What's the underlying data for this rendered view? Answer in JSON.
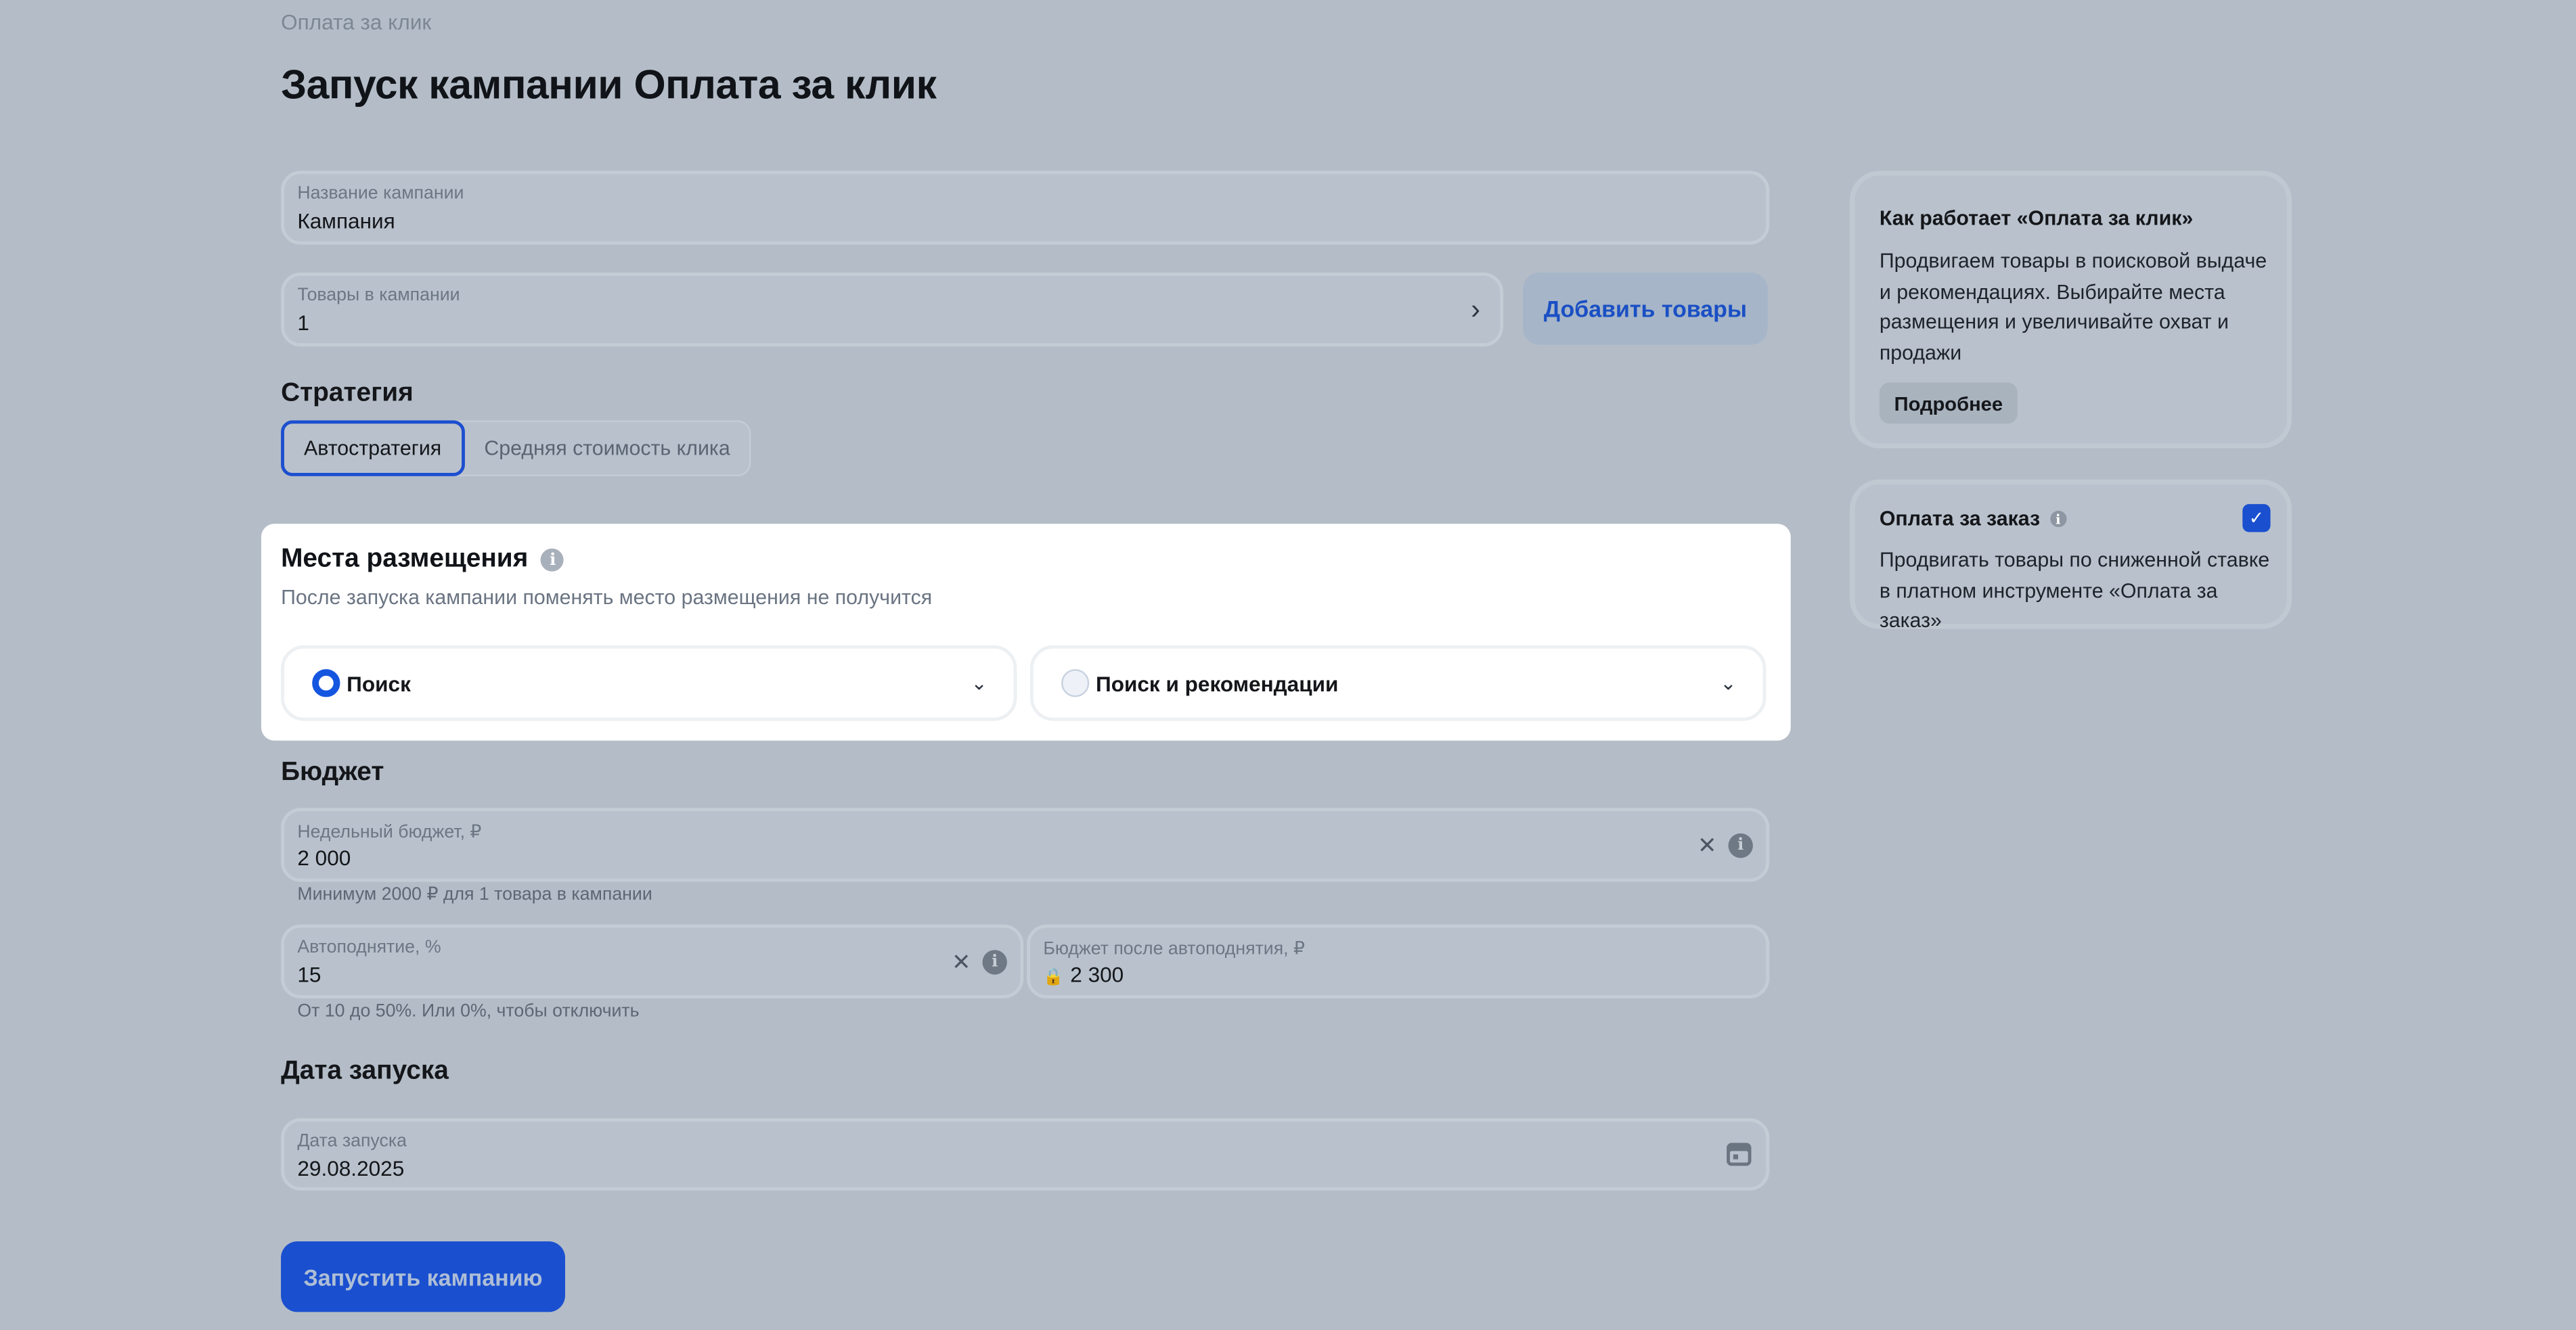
{
  "breadcrumb": "Оплата за клик",
  "page_title": "Запуск кампании Оплата за клик",
  "campaign_name": {
    "label": "Название кампании",
    "value": "Кампания"
  },
  "goods": {
    "label": "Товары в кампании",
    "value": "1",
    "add_button": "Добавить товары"
  },
  "strategy": {
    "title": "Стратегия",
    "options": [
      "Автостратегия",
      "Средняя стоимость клика"
    ],
    "selected": "Автостратегия"
  },
  "placements": {
    "title": "Места размещения",
    "subtitle": "После запуска кампании поменять место размещения не получится",
    "options": [
      {
        "label": "Поиск",
        "selected": true
      },
      {
        "label": "Поиск и рекомендации",
        "selected": false
      }
    ]
  },
  "budget": {
    "title": "Бюджет",
    "weekly_label": "Недельный бюджет, ₽",
    "weekly_value": "2 000",
    "weekly_hint": "Минимум 2000 ₽ для 1 товара в кампании",
    "autoraise_label": "Автоподнятие, %",
    "autoraise_value": "15",
    "autoraise_hint": "От 10 до 50%. Или 0%, чтобы отключить",
    "after_label": "Бюджет после автоподнятия, ₽",
    "after_value": "2 300"
  },
  "launch_date": {
    "title": "Дата запуска",
    "label": "Дата запуска",
    "value": "29.08.2025"
  },
  "launch_button": "Запустить кампанию",
  "info_card": {
    "title": "Как работает «Оплата за клик»",
    "text": "Продвигаем товары в поисковой выдаче и рекомендациях. Выбирайте места размещения и увеличивайте охват и продажи",
    "more_button": "Подробнее"
  },
  "order_card": {
    "title": "Оплата за заказ",
    "text": "Продвигать товары по сниженной ставке в платном инструменте «Оплата за заказ»",
    "checked": true
  },
  "colors": {
    "accent": "#1a4fcf",
    "backdrop": "#b4bdc7",
    "highlight": "#ffffff"
  },
  "icons": [
    "chevron-right-icon",
    "info-icon",
    "chevron-down-icon",
    "clear-icon",
    "lock-icon",
    "calendar-icon",
    "check-icon"
  ]
}
